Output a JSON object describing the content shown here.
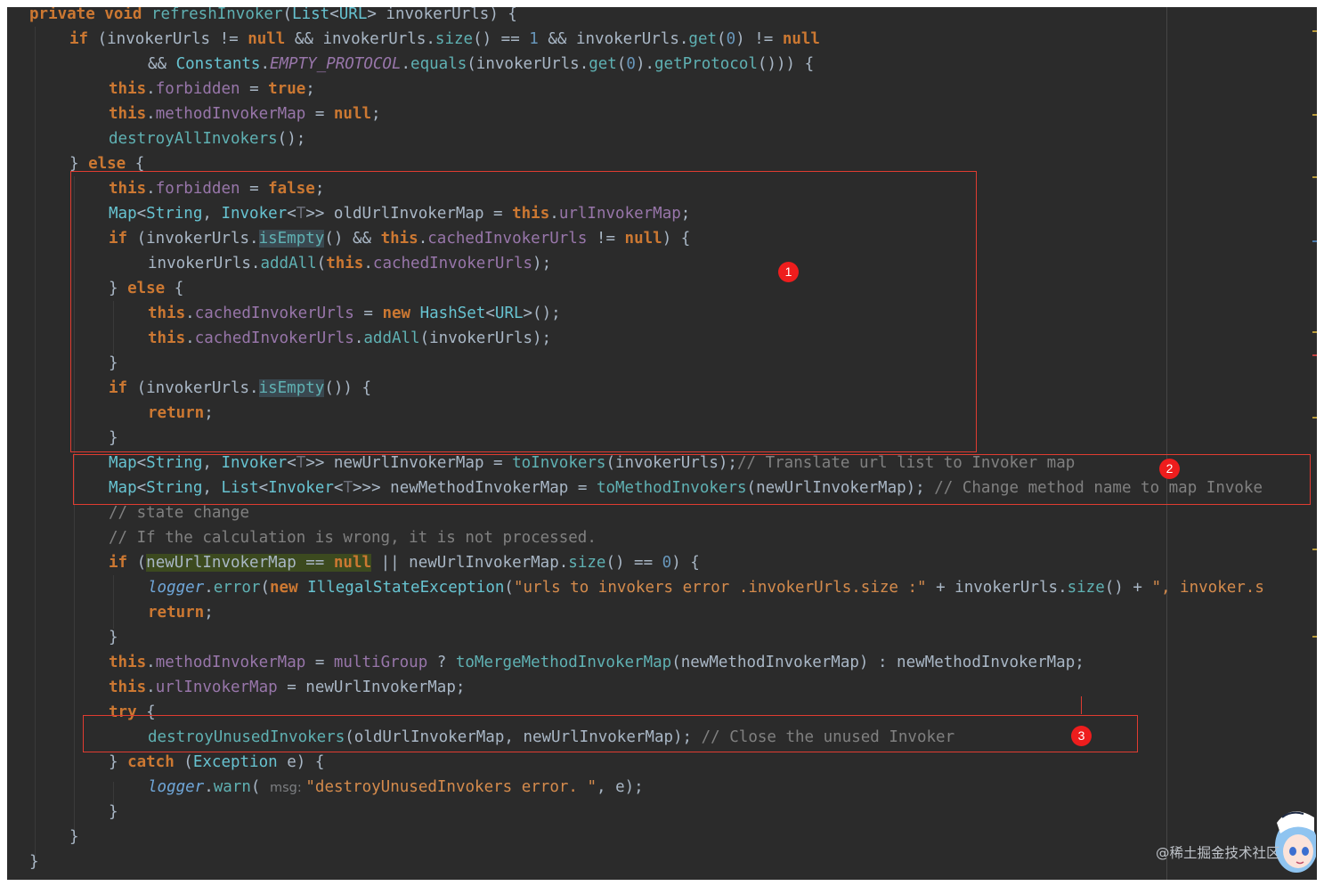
{
  "editor": {
    "code_lines": [
      {
        "parts": [
          {
            "t": "private ",
            "c": "kw"
          },
          {
            "t": "void ",
            "c": "kw"
          },
          {
            "t": "refreshInvoker",
            "c": "mth"
          },
          {
            "t": "("
          },
          {
            "t": "List",
            "c": "cls"
          },
          {
            "t": "<"
          },
          {
            "t": "URL",
            "c": "cls"
          },
          {
            "t": "> invokerUrls) {"
          }
        ]
      },
      {
        "parts": [
          {
            "t": "if ",
            "c": "kw"
          },
          {
            "t": "(invokerUrls != "
          },
          {
            "t": "null ",
            "c": "kw"
          },
          {
            "t": "&& invokerUrls."
          },
          {
            "t": "size",
            "c": "mth"
          },
          {
            "t": "() == "
          },
          {
            "t": "1 ",
            "c": "num"
          },
          {
            "t": "&& invokerUrls."
          },
          {
            "t": "get",
            "c": "mth"
          },
          {
            "t": "("
          },
          {
            "t": "0",
            "c": "num"
          },
          {
            "t": ") != "
          },
          {
            "t": "null",
            "c": "kw"
          }
        ]
      },
      {
        "parts": [
          {
            "t": "&& "
          },
          {
            "t": "Constants",
            "c": "cls"
          },
          {
            "t": "."
          },
          {
            "t": "EMPTY_PROTOCOL",
            "c": "sta"
          },
          {
            "t": "."
          },
          {
            "t": "equals",
            "c": "mth"
          },
          {
            "t": "(invokerUrls."
          },
          {
            "t": "get",
            "c": "mth"
          },
          {
            "t": "("
          },
          {
            "t": "0",
            "c": "num"
          },
          {
            "t": ")."
          },
          {
            "t": "getProtocol",
            "c": "mth"
          },
          {
            "t": "())) {"
          }
        ]
      },
      {
        "parts": [
          {
            "t": "this",
            "c": "kw"
          },
          {
            "t": "."
          },
          {
            "t": "forbidden",
            "c": "fld"
          },
          {
            "t": " = "
          },
          {
            "t": "true",
            "c": "kw"
          },
          {
            "t": ";"
          }
        ]
      },
      {
        "parts": [
          {
            "t": "this",
            "c": "kw"
          },
          {
            "t": "."
          },
          {
            "t": "methodInvokerMap",
            "c": "fld"
          },
          {
            "t": " = "
          },
          {
            "t": "null",
            "c": "kw"
          },
          {
            "t": ";"
          }
        ]
      },
      {
        "parts": [
          {
            "t": "destroyAllInvokers",
            "c": "mth"
          },
          {
            "t": "();"
          }
        ]
      },
      {
        "parts": [
          {
            "t": "} "
          },
          {
            "t": "else ",
            "c": "kw"
          },
          {
            "t": "{"
          }
        ]
      },
      {
        "parts": [
          {
            "t": "this",
            "c": "kw"
          },
          {
            "t": "."
          },
          {
            "t": "forbidden",
            "c": "fld"
          },
          {
            "t": " = "
          },
          {
            "t": "false",
            "c": "kw"
          },
          {
            "t": ";"
          }
        ]
      },
      {
        "parts": [
          {
            "t": "Map",
            "c": "cls"
          },
          {
            "t": "<"
          },
          {
            "t": "String",
            "c": "cls"
          },
          {
            "t": ", "
          },
          {
            "t": "Invoker",
            "c": "cls"
          },
          {
            "t": "<"
          },
          {
            "t": "T",
            "c": "gen"
          },
          {
            "t": ">> oldUrlInvokerMap = "
          },
          {
            "t": "this",
            "c": "kw"
          },
          {
            "t": "."
          },
          {
            "t": "urlInvokerMap",
            "c": "fld"
          },
          {
            "t": ";"
          }
        ]
      },
      {
        "parts": [
          {
            "t": "if ",
            "c": "kw"
          },
          {
            "t": "(invokerUrls."
          },
          {
            "t": "isEmpty",
            "c": "mth hl"
          },
          {
            "t": "() && "
          },
          {
            "t": "this",
            "c": "kw"
          },
          {
            "t": "."
          },
          {
            "t": "cachedInvokerUrls",
            "c": "fld"
          },
          {
            "t": " != "
          },
          {
            "t": "null",
            "c": "kw"
          },
          {
            "t": ") {"
          }
        ]
      },
      {
        "parts": [
          {
            "t": "invokerUrls."
          },
          {
            "t": "addAll",
            "c": "mth"
          },
          {
            "t": "("
          },
          {
            "t": "this",
            "c": "kw"
          },
          {
            "t": "."
          },
          {
            "t": "cachedInvokerUrls",
            "c": "fld"
          },
          {
            "t": ");"
          }
        ]
      },
      {
        "parts": [
          {
            "t": "} "
          },
          {
            "t": "else ",
            "c": "kw"
          },
          {
            "t": "{"
          }
        ]
      },
      {
        "parts": [
          {
            "t": "this",
            "c": "kw"
          },
          {
            "t": "."
          },
          {
            "t": "cachedInvokerUrls",
            "c": "fld"
          },
          {
            "t": " = "
          },
          {
            "t": "new ",
            "c": "kw"
          },
          {
            "t": "HashSet",
            "c": "cls"
          },
          {
            "t": "<"
          },
          {
            "t": "URL",
            "c": "cls"
          },
          {
            "t": ">();"
          }
        ]
      },
      {
        "parts": [
          {
            "t": "this",
            "c": "kw"
          },
          {
            "t": "."
          },
          {
            "t": "cachedInvokerUrls",
            "c": "fld"
          },
          {
            "t": "."
          },
          {
            "t": "addAll",
            "c": "mth"
          },
          {
            "t": "(invokerUrls);"
          }
        ]
      },
      {
        "parts": [
          {
            "t": "}"
          }
        ]
      },
      {
        "parts": [
          {
            "t": "if ",
            "c": "kw"
          },
          {
            "t": "(invokerUrls."
          },
          {
            "t": "isEmpty",
            "c": "mth hl"
          },
          {
            "t": "()) {"
          }
        ]
      },
      {
        "parts": [
          {
            "t": "return",
            "c": "kw"
          },
          {
            "t": ";"
          }
        ]
      },
      {
        "parts": [
          {
            "t": "}"
          }
        ]
      },
      {
        "parts": [
          {
            "t": "Map",
            "c": "cls"
          },
          {
            "t": "<"
          },
          {
            "t": "String",
            "c": "cls"
          },
          {
            "t": ", "
          },
          {
            "t": "Invoker",
            "c": "cls"
          },
          {
            "t": "<"
          },
          {
            "t": "T",
            "c": "gen"
          },
          {
            "t": ">> newUrlInvokerMap = "
          },
          {
            "t": "toInvokers",
            "c": "mth"
          },
          {
            "t": "(invokerUrls);"
          },
          {
            "t": "// Translate url list to Invoker map",
            "c": "cmt"
          }
        ]
      },
      {
        "parts": [
          {
            "t": "Map",
            "c": "cls"
          },
          {
            "t": "<"
          },
          {
            "t": "String",
            "c": "cls"
          },
          {
            "t": ", "
          },
          {
            "t": "List",
            "c": "cls"
          },
          {
            "t": "<"
          },
          {
            "t": "Invoker",
            "c": "cls"
          },
          {
            "t": "<"
          },
          {
            "t": "T",
            "c": "gen"
          },
          {
            "t": ">>> newMethodInvokerMap = "
          },
          {
            "t": "toMethodInvokers",
            "c": "mth"
          },
          {
            "t": "(newUrlInvokerMap); "
          },
          {
            "t": "// Change method name to map Invoke",
            "c": "cmt"
          }
        ]
      },
      {
        "parts": [
          {
            "t": "// state change",
            "c": "cmt"
          }
        ]
      },
      {
        "parts": [
          {
            "t": "// If the calculation is wrong, it is not processed.",
            "c": "cmt"
          }
        ]
      },
      {
        "parts": [
          {
            "t": "if ",
            "c": "kw"
          },
          {
            "t": "("
          },
          {
            "t": "newUrlInvokerMap == ",
            "c": "hl2"
          },
          {
            "t": "null",
            "c": "kw hl2"
          },
          {
            "t": " || newUrlInvokerMap."
          },
          {
            "t": "size",
            "c": "mth"
          },
          {
            "t": "() == "
          },
          {
            "t": "0",
            "c": "num"
          },
          {
            "t": ") {"
          }
        ]
      },
      {
        "parts": [
          {
            "t": "logger",
            "c": "log"
          },
          {
            "t": "."
          },
          {
            "t": "error",
            "c": "mth"
          },
          {
            "t": "("
          },
          {
            "t": "new ",
            "c": "kw"
          },
          {
            "t": "IllegalStateException",
            "c": "cls"
          },
          {
            "t": "("
          },
          {
            "t": "\"urls to invokers error .invokerUrls.size :\"",
            "c": "str"
          },
          {
            "t": " + invokerUrls."
          },
          {
            "t": "size",
            "c": "mth"
          },
          {
            "t": "() + "
          },
          {
            "t": "\", invoker.s",
            "c": "str"
          }
        ]
      },
      {
        "parts": [
          {
            "t": "return",
            "c": "kw"
          },
          {
            "t": ";"
          }
        ]
      },
      {
        "parts": [
          {
            "t": "}"
          }
        ]
      },
      {
        "parts": [
          {
            "t": "this",
            "c": "kw"
          },
          {
            "t": "."
          },
          {
            "t": "methodInvokerMap",
            "c": "fld"
          },
          {
            "t": " = "
          },
          {
            "t": "multiGroup",
            "c": "fld"
          },
          {
            "t": " ? "
          },
          {
            "t": "toMergeMethodInvokerMap",
            "c": "mth"
          },
          {
            "t": "(newMethodInvokerMap) : newMethodInvokerMap;"
          }
        ]
      },
      {
        "parts": [
          {
            "t": "this",
            "c": "kw"
          },
          {
            "t": "."
          },
          {
            "t": "urlInvokerMap",
            "c": "fld"
          },
          {
            "t": " = newUrlInvokerMap;"
          }
        ]
      },
      {
        "parts": [
          {
            "t": "try ",
            "c": "kw"
          },
          {
            "t": "{"
          }
        ]
      },
      {
        "parts": [
          {
            "t": "destroyUnusedInvokers",
            "c": "mth"
          },
          {
            "t": "(oldUrlInvokerMap, newUrlInvokerMap); "
          },
          {
            "t": "// Close the unused Invoker",
            "c": "cmt"
          }
        ]
      },
      {
        "parts": [
          {
            "t": "} "
          },
          {
            "t": "catch ",
            "c": "kw"
          },
          {
            "t": "("
          },
          {
            "t": "Exception",
            "c": "cls"
          },
          {
            "t": " e) {"
          }
        ]
      },
      {
        "parts": [
          {
            "t": "logger",
            "c": "log"
          },
          {
            "t": "."
          },
          {
            "t": "warn",
            "c": "mth"
          },
          {
            "t": "( "
          },
          {
            "t": "msg: ",
            "c": "hint"
          },
          {
            "t": "\"destroyUnusedInvokers error. \"",
            "c": "str"
          },
          {
            "t": ", e);"
          }
        ]
      },
      {
        "parts": [
          {
            "t": "}"
          }
        ]
      },
      {
        "parts": [
          {
            "t": "}"
          }
        ]
      },
      {
        "parts": [
          {
            "t": "}"
          }
        ]
      }
    ]
  },
  "annotations": {
    "badge_1": "1",
    "badge_2": "2",
    "badge_3": "3"
  },
  "watermark": "@稀土掘金技术社区"
}
